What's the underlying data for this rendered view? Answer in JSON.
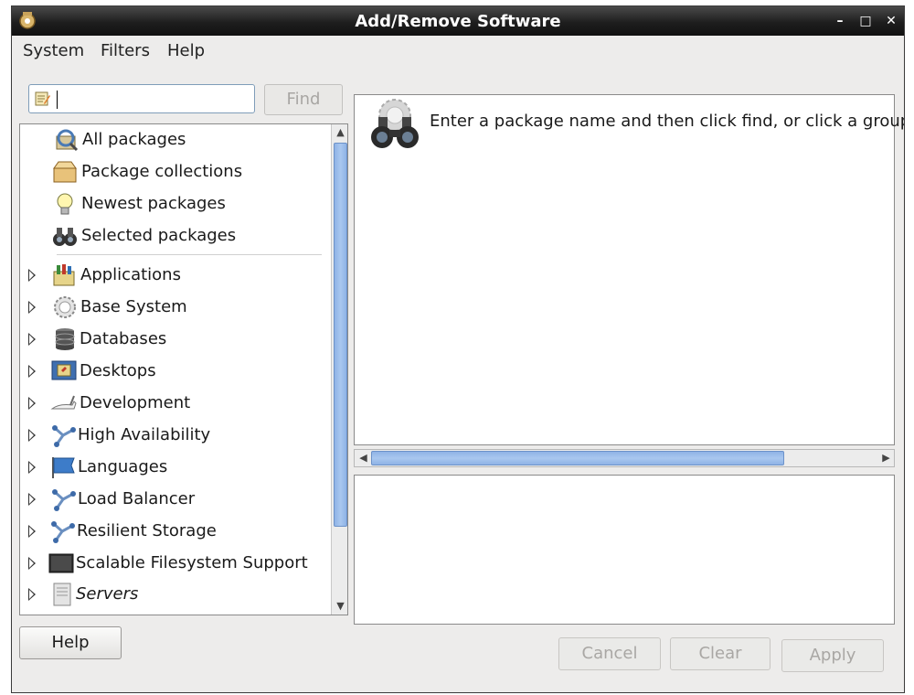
{
  "window": {
    "title": "Add/Remove Software",
    "controls": [
      "minimize-icon",
      "maximize-icon",
      "close-icon"
    ]
  },
  "menubar": {
    "items": [
      {
        "label": "System"
      },
      {
        "label": "Filters"
      },
      {
        "label": "Help"
      }
    ]
  },
  "search": {
    "value": "",
    "find_label": "Find",
    "find_enabled": false
  },
  "tree": {
    "filters": [
      {
        "label": "All packages",
        "icon": "magnifier-package-icon"
      },
      {
        "label": "Package collections",
        "icon": "package-collection-icon"
      },
      {
        "label": "Newest packages",
        "icon": "lightbulb-icon"
      },
      {
        "label": "Selected packages",
        "icon": "binoculars-icon"
      }
    ],
    "groups": [
      {
        "label": "Applications",
        "icon": "applications-icon"
      },
      {
        "label": "Base System",
        "icon": "gear-icon"
      },
      {
        "label": "Databases",
        "icon": "database-icon"
      },
      {
        "label": "Desktops",
        "icon": "desktop-icon"
      },
      {
        "label": "Development",
        "icon": "development-icon"
      },
      {
        "label": "High Availability",
        "icon": "network-icon"
      },
      {
        "label": "Languages",
        "icon": "flag-icon"
      },
      {
        "label": "Load Balancer",
        "icon": "network-icon"
      },
      {
        "label": "Resilient Storage",
        "icon": "network-icon"
      },
      {
        "label": "Scalable Filesystem Support",
        "icon": "monitor-icon"
      },
      {
        "label": "Servers",
        "icon": "server-icon"
      }
    ]
  },
  "details": {
    "message": "Enter a package name and then click find, or click a group t",
    "icon": "binoculars-gear-icon"
  },
  "buttons": {
    "help": "Help",
    "cancel": "Cancel",
    "clear": "Clear",
    "apply": "Apply"
  },
  "colors": {
    "titlebar": "#1e1e1e",
    "scroll_thumb": "#a9c7ef",
    "window_bg": "#edeceb"
  }
}
